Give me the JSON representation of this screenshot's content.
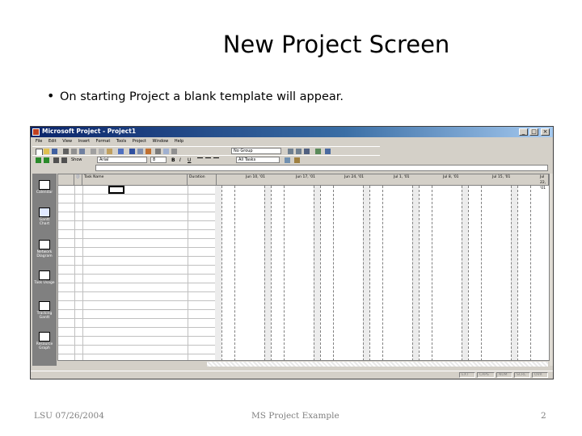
{
  "slide": {
    "title": "New Project Screen",
    "bullet": "On starting Project a blank template will appear."
  },
  "footer": {
    "left": "LSU 07/26/2004",
    "center": "MS Project Example",
    "right": "2"
  },
  "window": {
    "title": "Microsoft Project - Project1",
    "menu": [
      "File",
      "Edit",
      "View",
      "Insert",
      "Format",
      "Tools",
      "Project",
      "Window",
      "Help"
    ],
    "group_combo": "No Group",
    "font_combo": "Arial",
    "size_combo": "8",
    "filter_combo": "All Tasks",
    "show_label": "Show",
    "columns": {
      "info": "ⓘ",
      "task_name": "Task Name",
      "duration": "Duration"
    },
    "weeks": [
      "Jun 10, '01",
      "Jun 17, '01",
      "Jun 24, '01",
      "Jul 1, '01",
      "Jul 8, '01",
      "Jul 15, '01",
      "Jul 22, '01"
    ],
    "day_letters": [
      "S",
      "M",
      "T",
      "W",
      "T",
      "F",
      "S"
    ],
    "views": [
      "Calendar",
      "Gantt Chart",
      "Network Diagram",
      "Task Usage",
      "Tracking Gantt",
      "Resource Graph"
    ],
    "status": [
      "EXT",
      "CAPS",
      "NUM",
      "SCRL",
      "OVR"
    ]
  },
  "colors": {
    "titlebar": "#0a246a",
    "chrome": "#d4d0c8",
    "viewbar": "#808080"
  }
}
